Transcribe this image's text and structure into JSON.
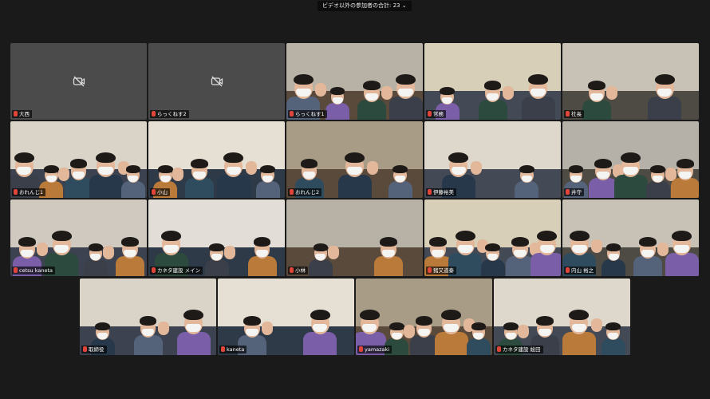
{
  "topbar": {
    "label": "ビデオ以外の参加者の合計: 23 ⌄"
  },
  "colors": {
    "accent": "#c9d86a",
    "mic_muted": "#e0453a"
  },
  "tiles": [
    {
      "name": "大西",
      "video": false
    },
    {
      "name": "らっくねす2",
      "video": false
    },
    {
      "name": "らっくねす1",
      "video": true
    },
    {
      "name": "常務",
      "video": true
    },
    {
      "name": "社長",
      "video": true
    },
    {
      "name": "おれんじ1",
      "video": true
    },
    {
      "name": "小山",
      "video": true
    },
    {
      "name": "おれんじ2",
      "video": true
    },
    {
      "name": "伊藤裕美",
      "video": true
    },
    {
      "name": "井守",
      "video": true
    },
    {
      "name": "cetsu kaneta",
      "video": true
    },
    {
      "name": "カネタ建設 メイン",
      "video": true,
      "active": true
    },
    {
      "name": "小林",
      "video": true
    },
    {
      "name": "猪又道泰",
      "video": true
    },
    {
      "name": "内山 裕之",
      "video": true
    },
    {
      "name": "取締役",
      "video": true
    },
    {
      "name": "kaneta",
      "video": true
    },
    {
      "name": "yamazaki",
      "video": true
    },
    {
      "name": "カネタ建設 絵田",
      "video": true
    }
  ]
}
